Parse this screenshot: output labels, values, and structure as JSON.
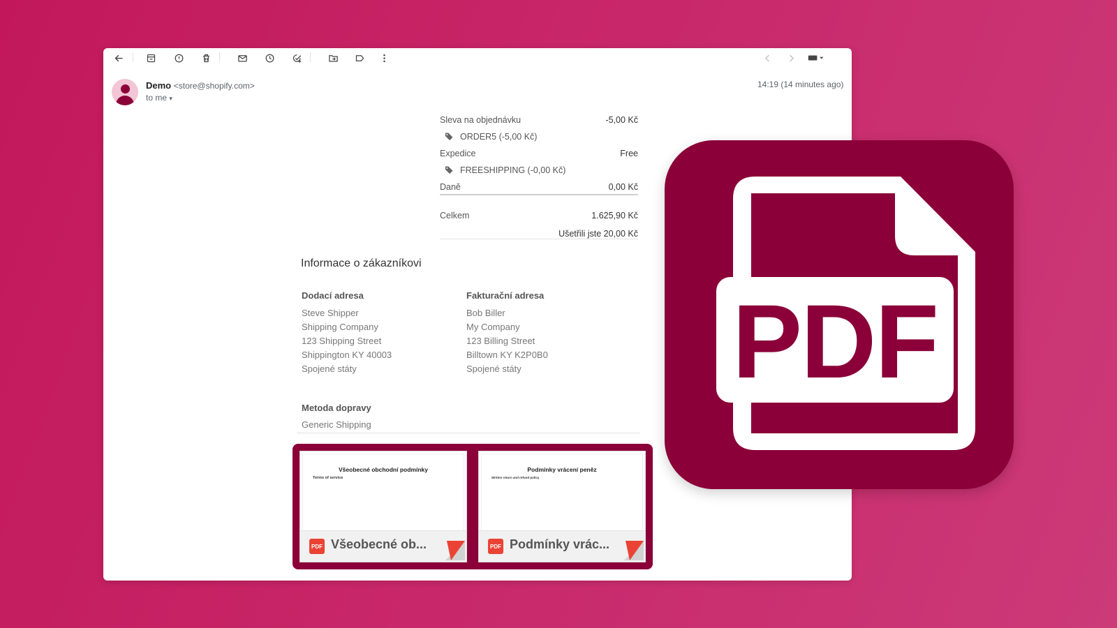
{
  "sender": {
    "name": "Demo",
    "email": "<store@shopify.com>",
    "to": "to me",
    "timestamp": "14:19 (14 minutes ago)"
  },
  "summary": {
    "discount_label": "Sleva na objednávku",
    "discount_value": "-5,00 Kč",
    "discount_code": "ORDER5 (-5,00 Kč)",
    "shipping_label": "Expedice",
    "shipping_value": "Free",
    "shipping_code": "FREESHIPPING (-0,00 Kč)",
    "taxes_label": "Daně",
    "taxes_value": "0,00 Kč",
    "total_label": "Celkem",
    "total_value": "1.625,90 Kč",
    "savings": "Ušetřili jste 20,00 Kč"
  },
  "customer": {
    "title": "Informace o zákazníkovi",
    "shipping_address": {
      "heading": "Dodací adresa",
      "lines": [
        "Steve Shipper",
        "Shipping Company",
        "123 Shipping Street",
        "Shippington KY 40003",
        "Spojené státy"
      ]
    },
    "billing_address": {
      "heading": "Fakturační adresa",
      "lines": [
        "Bob Biller",
        "My Company",
        "123 Billing Street",
        "Billtown KY K2P0B0",
        "Spojené státy"
      ]
    },
    "shipping_method_heading": "Metoda dopravy",
    "shipping_method": "Generic Shipping"
  },
  "attachments": [
    {
      "doc_title": "Všeobecné obchodní podmínky",
      "doc_sub": "Terms of service",
      "name": "Všeobecné ob...",
      "badge": "PDF"
    },
    {
      "doc_title": "Podmínky vrácení peněz",
      "doc_sub": "Written return and refund policy",
      "name": "Podmínky vrác...",
      "badge": "PDF"
    }
  ],
  "big_badge": {
    "text": "PDF"
  },
  "icons": {
    "toolbar": [
      "back-arrow-icon",
      "archive-icon",
      "report-spam-icon",
      "delete-icon",
      "mark-unread-icon",
      "snooze-icon",
      "add-to-tasks-icon",
      "move-to-icon",
      "label-icon",
      "more-vert-icon",
      "prev-icon",
      "next-icon",
      "keyboard-icon"
    ],
    "header": [
      "star-icon",
      "emoji-icon",
      "reply-icon",
      "more-vert-icon"
    ]
  },
  "colors": {
    "brand": "#8b0038",
    "background": "#c2185b",
    "pdf_red": "#ea4335"
  }
}
